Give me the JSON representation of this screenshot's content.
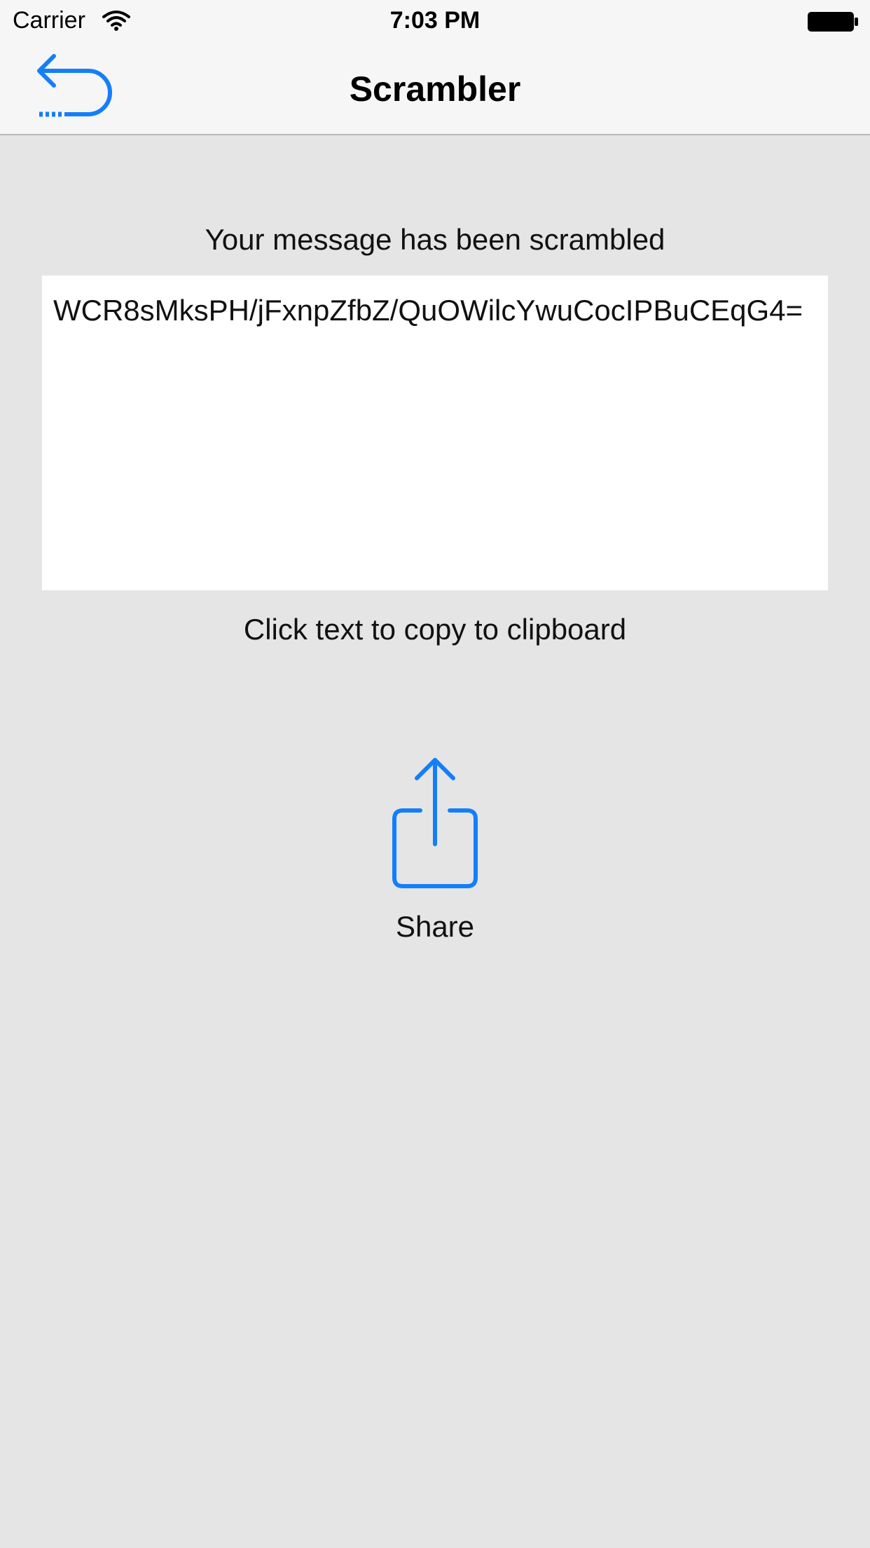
{
  "status_bar": {
    "carrier": "Carrier",
    "time": "7:03 PM",
    "wifi_icon": "wifi-icon",
    "battery_icon": "battery-icon"
  },
  "nav_bar": {
    "title": "Scrambler",
    "back_icon": "undo-arrow-icon"
  },
  "main": {
    "heading": "Your message has been scrambled",
    "scrambled_text": "WCR8sMksPH/jFxnpZfbZ/QuOWilcYwuCocIPBuCEqG4=",
    "hint": "Click text to copy to clipboard",
    "share_label": "Share",
    "share_icon": "share-icon"
  },
  "colors": {
    "accent": "#147efb",
    "background": "#e5e5e5",
    "bar_background": "#f6f6f6",
    "text_box_background": "#ffffff"
  }
}
